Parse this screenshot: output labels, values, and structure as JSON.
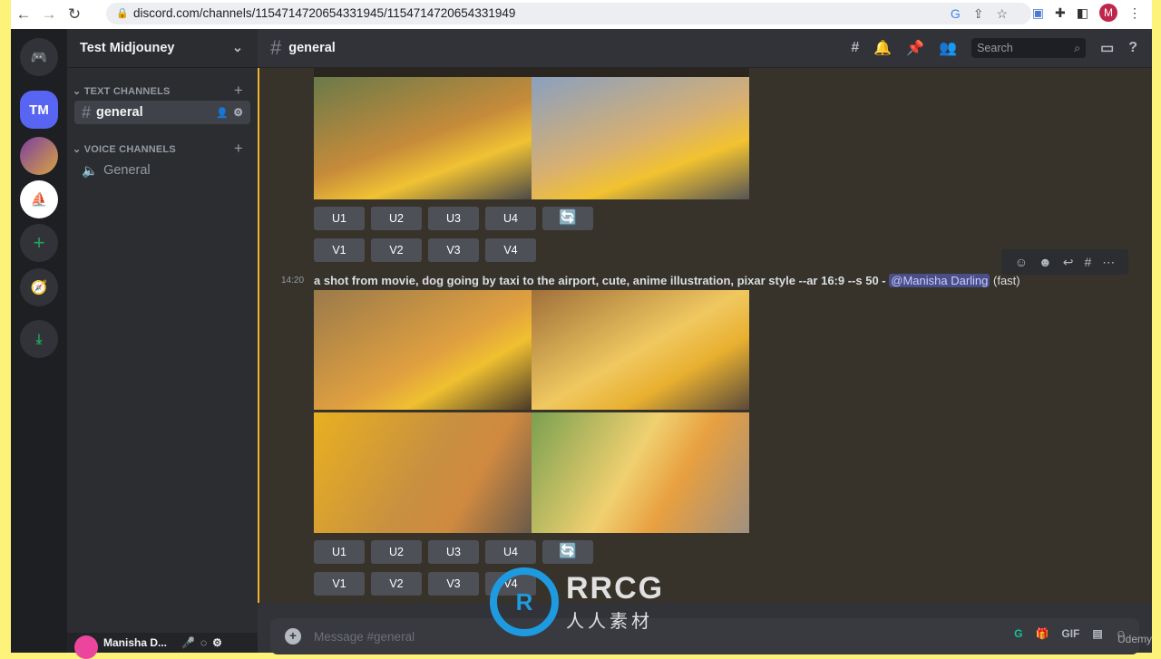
{
  "browser": {
    "url": "discord.com/channels/1154714720654331945/1154714720654331949",
    "profile": "M"
  },
  "server": {
    "name": "Test Midjouney",
    "abbr": "TM"
  },
  "sidebar": {
    "text_category": "TEXT CHANNELS",
    "voice_category": "VOICE CHANNELS",
    "text_channels": [
      {
        "name": "general"
      }
    ],
    "voice_channels": [
      {
        "name": "General"
      }
    ]
  },
  "user": {
    "name": "Manisha D..."
  },
  "header": {
    "channel": "general",
    "search_placeholder": "Search"
  },
  "messages": [
    {
      "buttons_u": [
        "U1",
        "U2",
        "U3",
        "U4"
      ],
      "buttons_v": [
        "V1",
        "V2",
        "V3",
        "V4"
      ]
    },
    {
      "time": "14:20",
      "prompt": "a shot from movie, dog going by taxi to the airport, cute, anime illustration, pixar style --ar 16:9 --s 50 -",
      "mention": "@Manisha Darling",
      "speed": "(fast)",
      "buttons_u": [
        "U1",
        "U2",
        "U3",
        "U4"
      ],
      "buttons_v": [
        "V1",
        "V2",
        "V3",
        "V4"
      ]
    }
  ],
  "composer": {
    "placeholder": "Message #general",
    "gif": "GIF"
  },
  "watermark": {
    "title": "RRCG",
    "subtitle": "人人素材",
    "corner": "Udemy"
  },
  "colors": {
    "accent": "#5865f2",
    "mention_bar": "#f0b232",
    "reroll": "#5dadec"
  }
}
